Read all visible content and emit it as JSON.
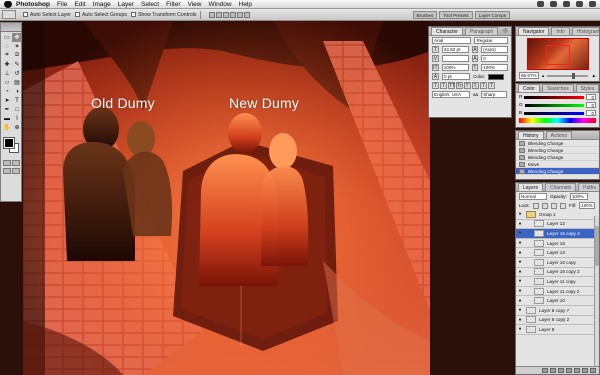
{
  "menubar": {
    "app": "Photoshop",
    "items": [
      "File",
      "Edit",
      "Image",
      "Layer",
      "Select",
      "Filter",
      "View",
      "Window",
      "Help"
    ]
  },
  "options_bar": {
    "auto_select_layer": "Auto Select Layer",
    "auto_select_groups": "Auto Select Groups",
    "show_transform": "Show Transform Controls",
    "wells": [
      "Brushes",
      "Tool Presets",
      "Layer Comps"
    ]
  },
  "canvas": {
    "label_left": "Old Dumy",
    "label_right": "New Dumy",
    "colors": {
      "bg_dark": "#3a0d06",
      "wall": "#a8321a",
      "floor": "#c84a2a",
      "tile": "#d9604a",
      "glow": "#ff7a3a"
    }
  },
  "character_palette": {
    "tabs": [
      "Character",
      "Paragraph"
    ],
    "font_family": "Arial",
    "font_style": "Regular",
    "size": "43.82 pt",
    "leading": "(Auto)",
    "tracking": "0",
    "vscale": "100%",
    "hscale": "100%",
    "baseline": "0 pt",
    "color_label": "Color:",
    "language": "English: USA",
    "antialias": "Sharp",
    "style_buttons": [
      "T",
      "T",
      "TT",
      "Tr",
      "T'",
      "T,",
      "T",
      "T"
    ]
  },
  "navigator_palette": {
    "tabs": [
      "Navigator",
      "Info",
      "Histogram"
    ],
    "zoom": "66.67%"
  },
  "color_palette": {
    "tabs": [
      "Color",
      "Swatches",
      "Styles"
    ],
    "channels": [
      {
        "label": "R",
        "value": "0"
      },
      {
        "label": "G",
        "value": "0"
      },
      {
        "label": "B",
        "value": "0"
      }
    ]
  },
  "history_palette": {
    "tabs": [
      "History",
      "Actions"
    ],
    "items": [
      "Blending Change",
      "Blending Change",
      "Blending Change",
      "Move",
      "Blending Change"
    ],
    "selected_index": 4
  },
  "layers_palette": {
    "tabs": [
      "Layers",
      "Channels",
      "Paths"
    ],
    "blend_mode": "Normal",
    "opacity_label": "Opacity:",
    "opacity": "100%",
    "lock_label": "Lock:",
    "fill_label": "Fill:",
    "fill": "100%",
    "layers": [
      {
        "name": "Group 1",
        "kind": "group"
      },
      {
        "name": "Layer 12",
        "kind": "layer"
      },
      {
        "name": "Layer 16 copy 3",
        "kind": "layer",
        "selected": true
      },
      {
        "name": "Layer 16",
        "kind": "layer"
      },
      {
        "name": "Layer 13",
        "kind": "layer"
      },
      {
        "name": "Layer 16 copy",
        "kind": "layer"
      },
      {
        "name": "Layer 16 copy 2",
        "kind": "layer"
      },
      {
        "name": "Layer 11 copy",
        "kind": "layer"
      },
      {
        "name": "Layer 11 copy 2",
        "kind": "layer"
      },
      {
        "name": "Layer 10",
        "kind": "layer"
      },
      {
        "name": "Layer 8 copy 7",
        "kind": "layer"
      },
      {
        "name": "Layer 8 copy 2",
        "kind": "layer"
      },
      {
        "name": "Layer 8",
        "kind": "layer"
      }
    ]
  }
}
